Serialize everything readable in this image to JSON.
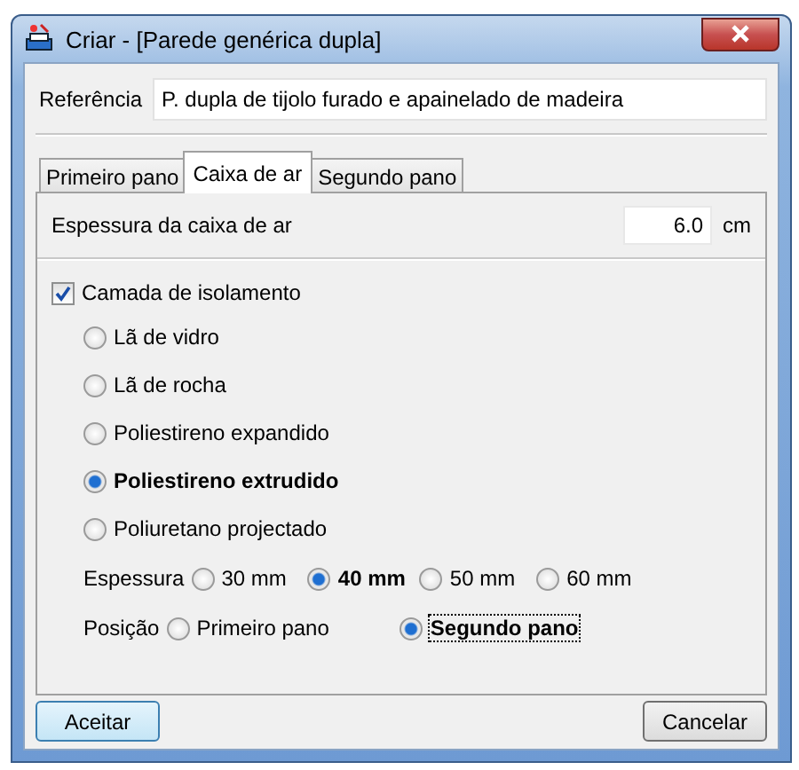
{
  "window": {
    "title": "Criar - [Parede genérica dupla]"
  },
  "reference": {
    "label": "Referência",
    "value": "P. dupla de tijolo furado e apainelado de madeira"
  },
  "tabs": [
    {
      "label": "Primeiro pano",
      "selected": false
    },
    {
      "label": "Caixa de ar",
      "selected": true
    },
    {
      "label": "Segundo pano",
      "selected": false
    }
  ],
  "air_gap": {
    "label": "Espessura da caixa de ar",
    "value": "6.0",
    "unit": "cm"
  },
  "insulation": {
    "label": "Camada de isolamento",
    "checked": true
  },
  "materials": [
    {
      "label": "Lã de vidro",
      "selected": false
    },
    {
      "label": "Lã de rocha",
      "selected": false
    },
    {
      "label": "Poliestireno expandido",
      "selected": false
    },
    {
      "label": "Poliestireno extrudido",
      "selected": true
    },
    {
      "label": "Poliuretano projectado",
      "selected": false
    }
  ],
  "thickness": {
    "label": "Espessura",
    "options": [
      {
        "label": "30 mm",
        "selected": false
      },
      {
        "label": "40 mm",
        "selected": true
      },
      {
        "label": "50 mm",
        "selected": false
      },
      {
        "label": "60 mm",
        "selected": false
      }
    ]
  },
  "position": {
    "label": "Posição",
    "options": [
      {
        "label": "Primeiro pano",
        "selected": false,
        "focused": false
      },
      {
        "label": "Segundo pano",
        "selected": true,
        "focused": true
      }
    ]
  },
  "buttons": [
    {
      "label": "Aceitar",
      "kind": "default"
    },
    {
      "label": "Cancelar",
      "kind": "normal"
    }
  ]
}
